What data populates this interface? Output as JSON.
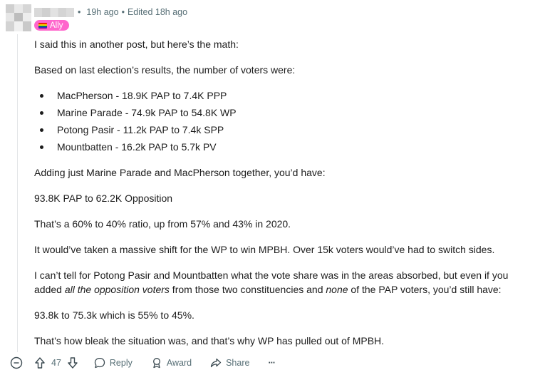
{
  "comment": {
    "time": "19h ago",
    "edited": "Edited 18h ago",
    "flair": "Ally",
    "paragraphs": {
      "p1": "I said this in another post, but here’s the math:",
      "p2": "Based on last election’s results, the number of voters were:",
      "p3": "Adding just Marine Parade and MacPherson together, you’d have:",
      "p4": "93.8K PAP to 62.2K Opposition",
      "p5": "That’s a 60% to 40% ratio, up from 57% and 43% in 2020.",
      "p6": "It would’ve taken a massive shift for the WP to win MPBH. Over 15k voters would’ve had to switch sides.",
      "p7a": "I can’t tell for Potong Pasir and Mountbatten what the vote share was in the areas absorbed, but even if you",
      "p7b_pre": "added ",
      "p7b_em1": "all the opposition voters",
      "p7b_mid": " from those two constituencies and ",
      "p7b_em2": "none",
      "p7b_post": " of the PAP voters, you’d still have:",
      "p8": "93.8k to 75.3k which is 55% to 45%.",
      "p9": "That’s how bleak the situation was, and that’s why WP has pulled out of MPBH."
    },
    "list": [
      "MacPherson - 18.9K PAP to 7.4K PPP",
      "Marine Parade - 74.9k PAP to 54.8K WP",
      "Potong Pasir - 11.2k PAP to 7.4k SPP",
      "Mountbatten - 16.2k PAP to 5.7k PV"
    ]
  },
  "actions": {
    "collapse_icon": "minus-circle-icon",
    "upvote_icon": "arrow-up-icon",
    "score": "47",
    "downvote_icon": "arrow-down-icon",
    "reply": "Reply",
    "award": "Award",
    "share": "Share",
    "more": "···"
  },
  "colors": {
    "flair": "#ff66cc",
    "meta": "#576f76",
    "text": "#1c1c1c"
  }
}
